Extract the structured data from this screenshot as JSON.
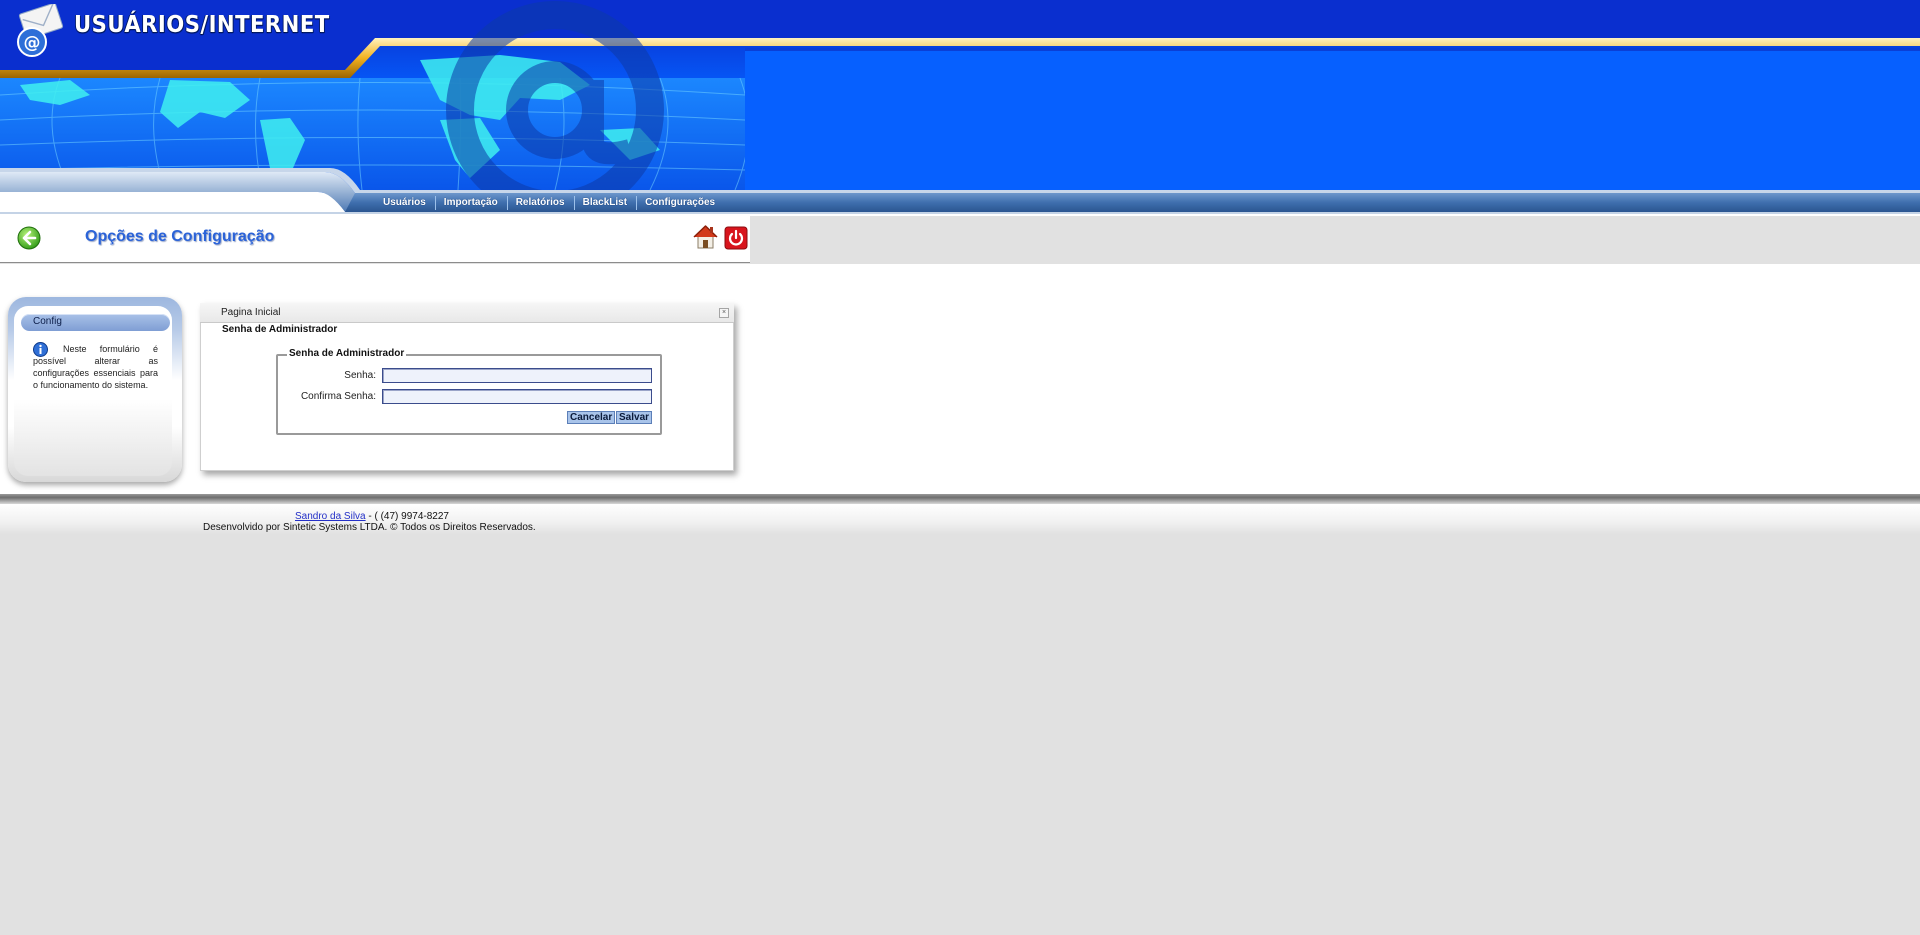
{
  "app": {
    "title": "USUÁRIOS/INTERNET"
  },
  "nav": {
    "items": [
      {
        "label": "Usuários"
      },
      {
        "label": "Importação"
      },
      {
        "label": "Relatórios"
      },
      {
        "label": "BlackList"
      },
      {
        "label": "Configurações"
      }
    ]
  },
  "page": {
    "title": "Opções de Configuração"
  },
  "sidebar": {
    "header": "Config",
    "info_text": "Neste formulário é possível alterar as configurações essenciais para o funcionamento do sistema."
  },
  "panel": {
    "tab_label": "Pagina Inicial",
    "subtitle": "Senha de Administrador",
    "legend": "Senha de Administrador",
    "fields": {
      "senha_label": "Senha:",
      "senha_value": "",
      "confirma_label": "Confirma Senha:",
      "confirma_value": ""
    },
    "buttons": {
      "cancel": "Cancelar",
      "save": "Salvar"
    }
  },
  "footer": {
    "author_link": "Sandro da Silva",
    "phone": " - ( (47) 9974-8227",
    "copyright": "Desenvolvido por Sintetic Systems LTDA. © Todos os Direitos Reservados."
  },
  "colors": {
    "header_blue": "#0660ff",
    "header_dark": "#0326c2",
    "gold": "#f2b220",
    "title_blue": "#2b63d8",
    "button_bg": "#a9c4ea"
  },
  "icons": {
    "logo": "envelope-at-icon",
    "back": "back-arrow-icon",
    "home": "home-icon",
    "power": "power-icon",
    "info": "info-icon",
    "close": "close-icon"
  }
}
